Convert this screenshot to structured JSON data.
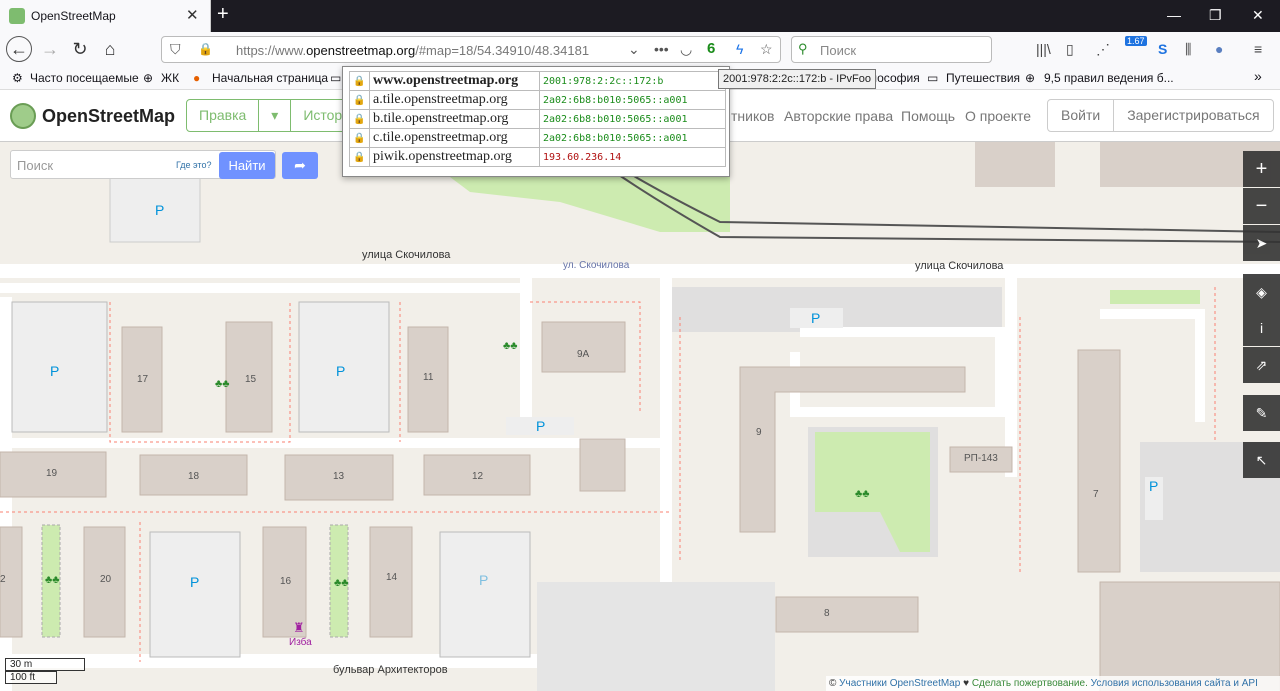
{
  "browser": {
    "tab_title": "OpenStreetMap",
    "url_prefix": "https://www.",
    "url_domain": "openstreetmap.org",
    "url_rest": "/#map=18/54.34910/48.34181",
    "ipfoo_badge": "6",
    "search_placeholder": "Поиск",
    "tooltip": "2001:978:2:2c::172:b - IPvFoo",
    "sync_badge": "1.67",
    "bookmarks": [
      "Часто посещаемые",
      "ЖК",
      "Начальная страница",
      "лософия",
      "Путешествия",
      "9,5 правил ведения б..."
    ]
  },
  "ipvfoo": {
    "rows": [
      {
        "domain": "www.openstreetmap.org",
        "ip": "2001:978:2:2c::172:b",
        "kind": "ipv6",
        "bold": true
      },
      {
        "domain": "a.tile.openstreetmap.org",
        "ip": "2a02:6b8:b010:5065::a001",
        "kind": "ipv6"
      },
      {
        "domain": "b.tile.openstreetmap.org",
        "ip": "2a02:6b8:b010:5065::a001",
        "kind": "ipv6"
      },
      {
        "domain": "c.tile.openstreetmap.org",
        "ip": "2a02:6b8:b010:5065::a001",
        "kind": "ipv6"
      },
      {
        "domain": "piwik.openstreetmap.org",
        "ip": "193.60.236.14",
        "kind": "ipv4"
      }
    ]
  },
  "osm": {
    "title": "OpenStreetMap",
    "edit": "Правка",
    "history": "Истори",
    "links": [
      "тников",
      "Авторские права",
      "Помощь",
      "О проекте"
    ],
    "login": "Войти",
    "signup": "Зарегистрироваться",
    "search_placeholder": "Поиск",
    "where": "Где это?",
    "go": "Найти"
  },
  "map": {
    "streets": [
      "улица Скочилова",
      "ул. Скочилова",
      "улица Скочилова",
      "бульвар Архитекторов"
    ],
    "buildings": [
      "17",
      "15",
      "11",
      "9А",
      "19",
      "18",
      "13",
      "12",
      "9",
      "РП-143",
      "7",
      "20",
      "16",
      "14",
      "8",
      "2"
    ],
    "parking": "P",
    "poi_label": "Изба",
    "scale_m": "30 m",
    "scale_ft": "100 ft",
    "attribution": {
      "prefix": "©",
      "contributors": "Участники OpenStreetMap",
      "heart": "♥",
      "donate": "Сделать пожертвование.",
      "terms": "Условия использования сайта и API"
    }
  }
}
